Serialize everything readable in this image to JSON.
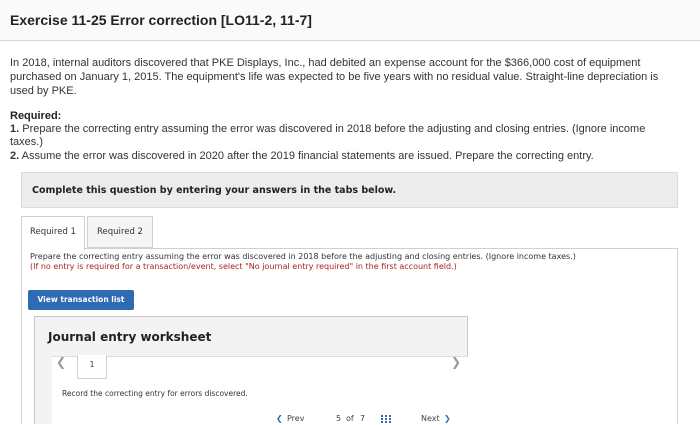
{
  "header": {
    "title": "Exercise 11-25 Error correction [LO11-2, 11-7]"
  },
  "intro": {
    "line1": "In 2018, internal auditors discovered that PKE Displays, Inc., had debited an expense account for the $366,000 cost of equipment",
    "line2": "purchased on January 1, 2015. The equipment's life was expected to be five years with no residual value. Straight-line depreciation is",
    "line3": "used by PKE."
  },
  "required": {
    "title": "Required:",
    "item1_num": "1.",
    "item1_line1": "Prepare the correcting entry assuming the error was discovered in 2018 before the adjusting and closing entries. (Ignore income",
    "item1_line2": "taxes.)",
    "item2_num": "2.",
    "item2_text": "Assume the error was discovered in 2020 after the 2019 financial statements are issued. Prepare the correcting entry."
  },
  "complete_bar": {
    "text": "Complete this question by entering your answers in the tabs below."
  },
  "tabs": [
    {
      "label": "Required 1"
    },
    {
      "label": "Required 2"
    }
  ],
  "instructions": {
    "line1": "Prepare the correcting entry assuming the error was discovered in 2018 before the adjusting and closing entries. (Ignore income taxes.)",
    "line2": "(If no entry is required for a transaction/event, select \"No journal entry required\" in the first account field.)"
  },
  "view_button": {
    "label": "View transaction list"
  },
  "worksheet": {
    "title": "Journal entry worksheet",
    "page": "1",
    "record_text": "Record the correcting entry for errors discovered."
  },
  "pager": {
    "prev_label": "Prev",
    "current": "5",
    "of_label": "of",
    "total": "7",
    "next_label": "Next"
  },
  "colors": {
    "accent": "#2f6ab5",
    "bar_bg": "#ececec"
  },
  "icons": [
    "chevron-left-icon",
    "chevron-right-icon",
    "grid-icon"
  ]
}
